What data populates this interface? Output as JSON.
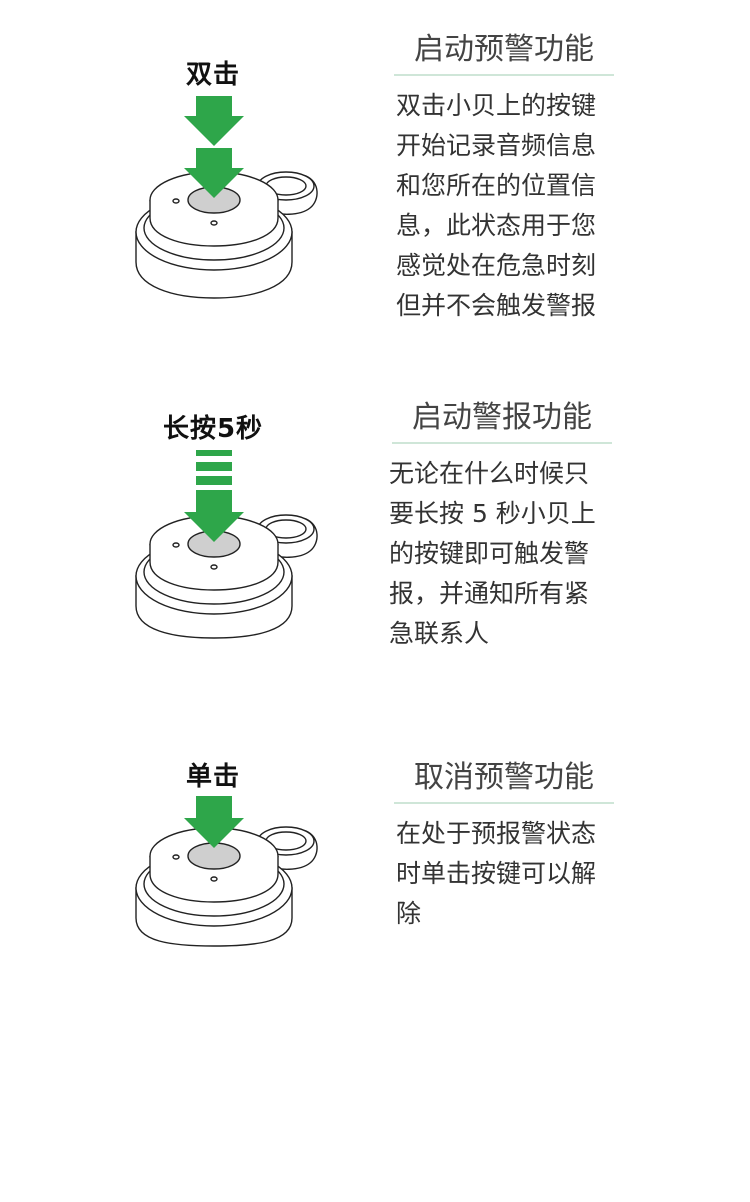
{
  "colors": {
    "accent": "#2ea64a",
    "divider": "#cfe6d8",
    "title": "#444444",
    "text": "#333333"
  },
  "sections": [
    {
      "action": "双击",
      "gesture": "double-press",
      "title": "启动预警功能",
      "description": "双击小贝上的按键开始记录音频信息和您所在的位置信息，此状态用于您感觉处在危急时刻但并不会触发警报"
    },
    {
      "action": "长按5秒",
      "gesture": "long-press",
      "title": "启动警报功能",
      "description": "无论在什么时候只要长按 5 秒小贝上的按键即可触发警报，并通知所有紧急联系人"
    },
    {
      "action": "单击",
      "gesture": "single-press",
      "title": "取消预警功能",
      "description": "在处于预报警状态时单击按键可以解除"
    }
  ]
}
